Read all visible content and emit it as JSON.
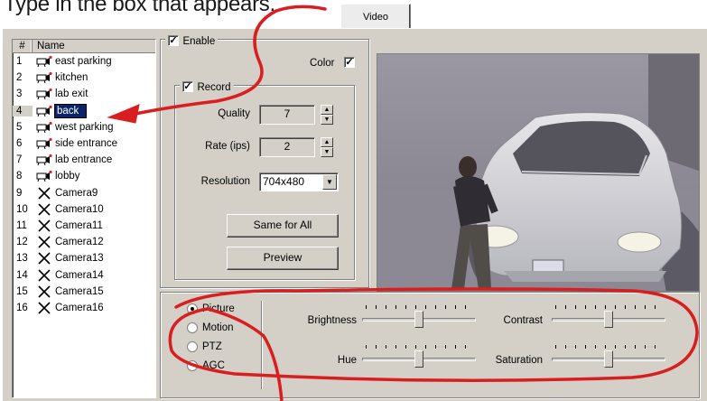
{
  "instruction": "Type in the box that appears.",
  "tab": {
    "label": "Video"
  },
  "camera_list": {
    "col_num": "#",
    "col_name": "Name",
    "items": [
      {
        "num": "1",
        "name": "east parking",
        "icon": "camera-icon"
      },
      {
        "num": "2",
        "name": "kitchen",
        "icon": "camera-icon"
      },
      {
        "num": "3",
        "name": "lab exit",
        "icon": "camera-icon"
      },
      {
        "num": "4",
        "name": "back",
        "icon": "camera-icon",
        "editing": true
      },
      {
        "num": "5",
        "name": "west parking",
        "icon": "camera-icon"
      },
      {
        "num": "6",
        "name": "side entrance",
        "icon": "camera-icon"
      },
      {
        "num": "7",
        "name": "lab entrance",
        "icon": "camera-icon"
      },
      {
        "num": "8",
        "name": "lobby",
        "icon": "camera-icon"
      },
      {
        "num": "9",
        "name": "Camera9",
        "icon": "x-icon"
      },
      {
        "num": "10",
        "name": "Camera10",
        "icon": "x-icon"
      },
      {
        "num": "11",
        "name": "Camera11",
        "icon": "x-icon"
      },
      {
        "num": "12",
        "name": "Camera12",
        "icon": "x-icon"
      },
      {
        "num": "13",
        "name": "Camera13",
        "icon": "x-icon"
      },
      {
        "num": "14",
        "name": "Camera14",
        "icon": "x-icon"
      },
      {
        "num": "15",
        "name": "Camera15",
        "icon": "x-icon"
      },
      {
        "num": "16",
        "name": "Camera16",
        "icon": "x-icon"
      }
    ]
  },
  "enable": {
    "label": "Enable",
    "checked": true
  },
  "color": {
    "label": "Color",
    "checked": true
  },
  "record": {
    "label": "Record",
    "checked": true,
    "quality_label": "Quality",
    "quality_value": "7",
    "rate_label": "Rate (ips)",
    "rate_value": "2",
    "resolution_label": "Resolution",
    "resolution_value": "704x480"
  },
  "buttons": {
    "same_for_all": "Same for All",
    "preview": "Preview"
  },
  "modes": {
    "selected": "Picture",
    "options": [
      "Picture",
      "Motion",
      "PTZ",
      "AGC"
    ]
  },
  "picture_settings": {
    "brightness_label": "Brightness",
    "brightness_level": 0.5,
    "contrast_label": "Contrast",
    "contrast_level": 0.5,
    "hue_label": "Hue",
    "hue_level": 0.5,
    "saturation_label": "Saturation",
    "saturation_level": 0.5
  },
  "colors": {
    "annotation": "#d81e1e",
    "selection": "#0a246a",
    "panel": "#d4d0c8"
  }
}
